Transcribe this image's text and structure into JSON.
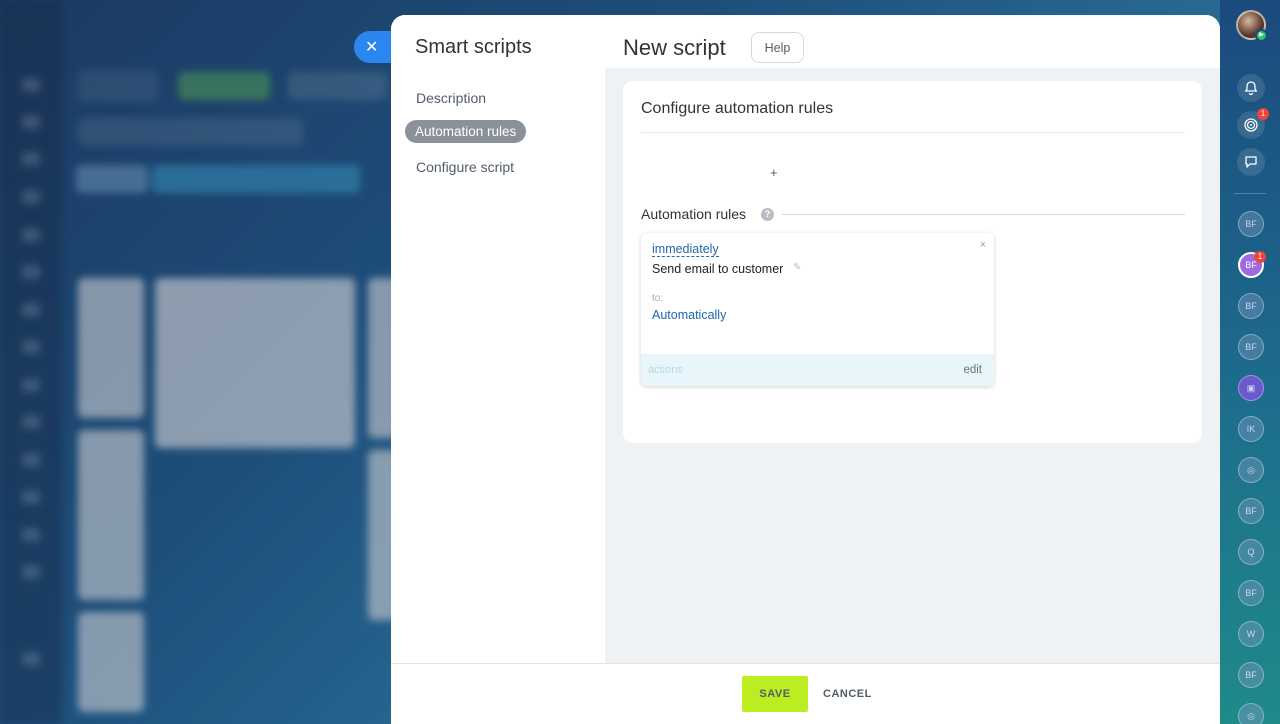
{
  "slider": {
    "close_icon": "close-icon",
    "nav": {
      "title": "Smart scripts",
      "items": [
        {
          "label": "Description",
          "active": false
        },
        {
          "label": "Automation rules",
          "active": true
        },
        {
          "label": "Configure script",
          "active": false
        }
      ]
    },
    "header": {
      "title": "New script",
      "help_label": "Help"
    },
    "card": {
      "title": "Configure automation rules",
      "add_label": "+",
      "section_label": "Automation rules",
      "help_icon": "?",
      "rule": {
        "delay": "immediately",
        "name": "Send email to customer",
        "to_label": "to:",
        "recipient": "Automatically",
        "actions_label": "actions",
        "edit_label": "edit",
        "close_glyph": "×"
      }
    },
    "footer": {
      "save_label": "SAVE",
      "cancel_label": "CANCEL"
    }
  },
  "right_rail": {
    "notification_icon": "bell-icon",
    "activity_badge": "1",
    "chat_icon": "chat-icon",
    "users": [
      {
        "initials": "BF",
        "badge": null
      },
      {
        "initials": "BF",
        "badge": "1"
      },
      {
        "initials": "BF",
        "badge": null
      },
      {
        "initials": "BF",
        "badge": null
      },
      {
        "initials": "",
        "badge": null
      },
      {
        "initials": "IK",
        "badge": null
      },
      {
        "initials": "",
        "badge": null
      },
      {
        "initials": "BF",
        "badge": null
      },
      {
        "initials": "Q",
        "badge": null
      },
      {
        "initials": "BF",
        "badge": null
      },
      {
        "initials": "W",
        "badge": null
      },
      {
        "initials": "BF",
        "badge": null
      }
    ]
  },
  "colors": {
    "save_button": "#bbed21",
    "close_button": "#2b86f0",
    "link": "#2067b0",
    "active_nav": "#8a9199"
  }
}
